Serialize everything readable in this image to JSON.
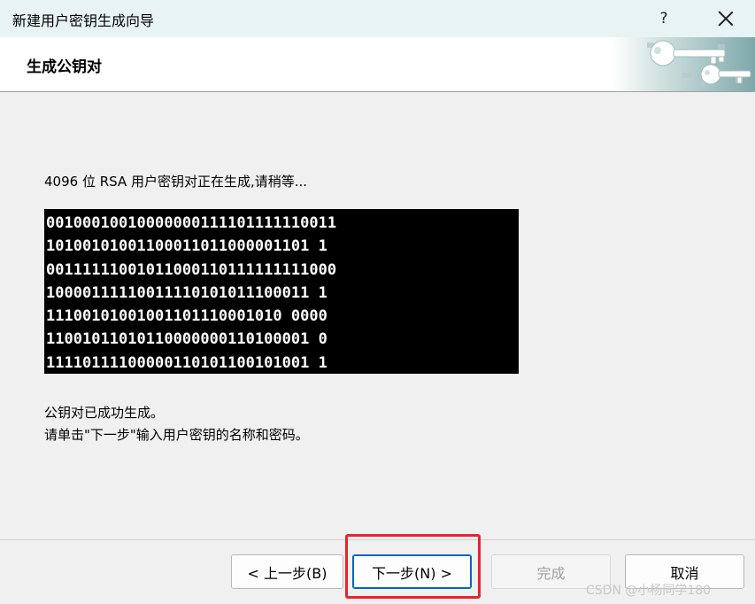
{
  "window": {
    "title": "新建用户密钥生成向导",
    "help_label": "?",
    "close_icon": "close-icon"
  },
  "header": {
    "title": "生成公钥对",
    "art_icon": "keys-icon"
  },
  "content": {
    "status": "4096 位 RSA 用户密钥对正在生成,请稍等...",
    "binary_lines": [
      "00100010010000000111101111110011",
      "10100101001100011011000001101 1",
      "00111111001011000110111111111000",
      "10000111110011110101011100011 1",
      "11100101001001101110001010 0000",
      "11001011010110000000110100001 0",
      "11110111100000110101100101001 1"
    ],
    "done_line1": "公钥对已成功生成。",
    "done_line2": "请单击\"下一步\"输入用户密钥的名称和密码。"
  },
  "buttons": {
    "prev": "< 上一步(B)",
    "next": "下一步(N) >",
    "finish": "完成",
    "cancel": "取消"
  },
  "watermark": "CSDN @小杨同学180"
}
